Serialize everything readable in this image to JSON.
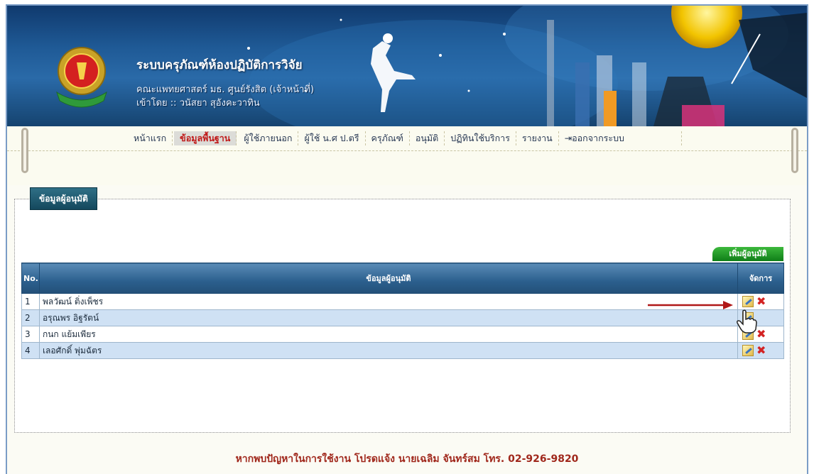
{
  "header": {
    "title": "ระบบครุภัณฑ์ห้องปฏิบัติการวิจัย",
    "subtitle": "คณะแพทยศาสตร์ มธ. ศูนย์รังสิต (เจ้าหน้าที่)",
    "user_line": "เข้าโดย :: วนัสยา สุอังคะวาทิน"
  },
  "menu": {
    "items": [
      {
        "label": "หน้าแรก",
        "active": false
      },
      {
        "label": "ข้อมูลพื้นฐาน",
        "active": true
      },
      {
        "label": "ผู้ใช้ภายนอก",
        "active": false
      },
      {
        "label": "ผู้ใช้ น.ศ ป.ตรี",
        "active": false
      },
      {
        "label": "ครุภัณฑ์",
        "active": false
      },
      {
        "label": "อนุมัติ",
        "active": false
      },
      {
        "label": "ปฏิทินใช้บริการ",
        "active": false
      },
      {
        "label": "รายงาน",
        "active": false
      },
      {
        "label": "ออกจากระบบ",
        "active": false
      }
    ]
  },
  "panel": {
    "legend": "ข้อมูลผู้อนุมัติ",
    "add_button": "เพิ่มผู้อนุมัติ"
  },
  "table": {
    "headers": {
      "no": "No.",
      "info": "ข้อมูลผู้อนุมัติ",
      "manage": "จัดการ"
    },
    "rows": [
      {
        "no": "1",
        "name": "พลวัฒน์ ติ่งเพ็ชร"
      },
      {
        "no": "2",
        "name": "อรุณพร อิฐรัตน์"
      },
      {
        "no": "3",
        "name": "กนก แย้มเพียร"
      },
      {
        "no": "4",
        "name": "เลอศักดิ์ พุ่มฉัตร"
      }
    ]
  },
  "footer": {
    "text": "หากพบปัญหาในการใช้งาน โปรดแจ้ง นายเฉลิม จันทร์สม โทร. 02-926-9820"
  },
  "colors": {
    "menu_active": "#c01919",
    "table_header": "#2b5f8d",
    "row_alt": "#cfe1f4",
    "footer_text": "#a0281c",
    "add_button": "#1c8f24"
  },
  "icons": [
    "university-seal-logo",
    "edit-icon",
    "delete-icon",
    "pointer-hand-cursor",
    "red-arrow"
  ]
}
